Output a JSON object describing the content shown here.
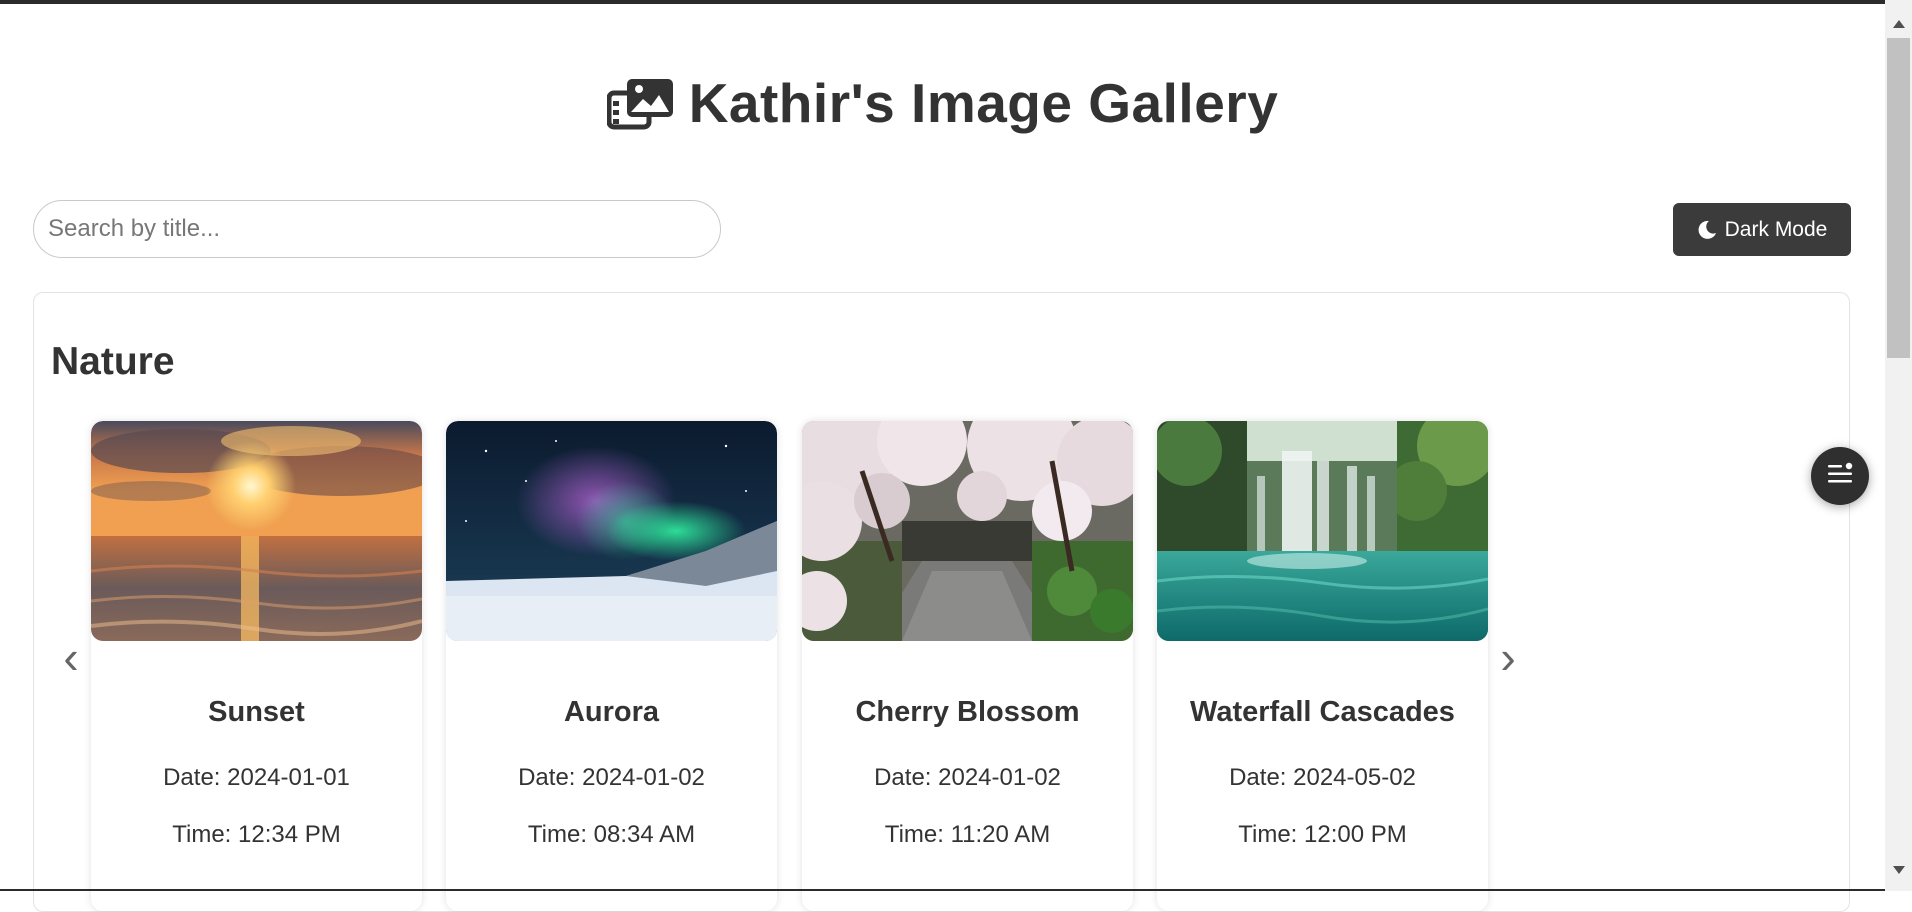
{
  "header": {
    "title": "Kathir's Image Gallery",
    "logo_icon": "images-icon"
  },
  "search": {
    "placeholder": "Search by title...",
    "value": ""
  },
  "theme_toggle": {
    "label": "Dark Mode",
    "icon": "moon-icon"
  },
  "section": {
    "title": "Nature",
    "prev_arrow": "‹",
    "next_arrow": "›",
    "cards": [
      {
        "title": "Sunset",
        "date": "Date: 2024-01-01",
        "time": "Time: 12:34 PM"
      },
      {
        "title": "Aurora",
        "date": "Date: 2024-01-02",
        "time": "Time: 08:34 AM"
      },
      {
        "title": "Cherry Blossom",
        "date": "Date: 2024-01-02",
        "time": "Time: 11:20 AM"
      },
      {
        "title": "Waterfall Cascades",
        "date": "Date: 2024-05-02",
        "time": "Time: 12:00 PM"
      }
    ]
  },
  "floating_button": {
    "icon": "menu-icon"
  },
  "colors": {
    "button_bg": "#3b3b3b",
    "text": "#333333",
    "fab_bg": "#2f2f2f"
  }
}
